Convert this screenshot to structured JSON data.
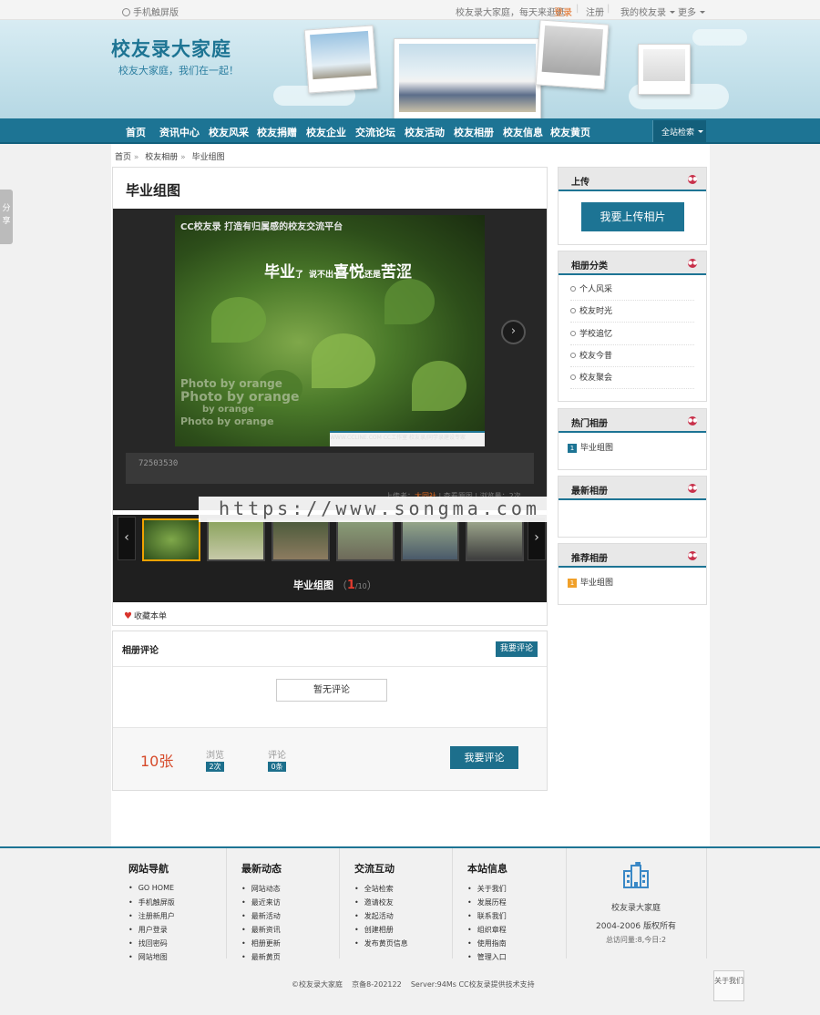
{
  "topbar": {
    "mobile": "手机触屏版",
    "welcome": "校友录大家庭，每天来逛逛",
    "login": "登录",
    "register": "注册",
    "my_alumni": "我的校友录",
    "more": "更多"
  },
  "banner": {
    "title": "校友录大家庭",
    "slogan": "校友大家庭，我们在一起！"
  },
  "nav": {
    "items": [
      "首页",
      "资讯中心",
      "校友风采",
      "校友捐赠",
      "校友企业",
      "交流论坛",
      "校友活动",
      "校友相册",
      "校友信息",
      "校友黄页"
    ],
    "search": "全站检索"
  },
  "breadcrumb": [
    "首页",
    "校友相册",
    "毕业组图"
  ],
  "album": {
    "title": "毕业组图",
    "photo_text": {
      "top": "CC校友录 打造有归属感的校友交流平台",
      "big_1": "毕业",
      "big_small_1": "了",
      "big_small_2": "说不出",
      "big_2": "喜悦",
      "big_small_3": "还是",
      "big_3": "苦涩",
      "watermarks": [
        "Photo by orange",
        "Photo by orange",
        "by orange",
        "Photo by orange"
      ],
      "footer": "WWW.CCLINE.COM CC工作室 校友录/同学录建设专家"
    },
    "caption": "72503530",
    "uploader_label": "上传者：",
    "uploader": "大同社",
    "original_label": "查看原图",
    "views_label": "浏览量：2次",
    "counter_name": "毕业组图",
    "counter_current": "1",
    "counter_total": "/10",
    "favorite": "收藏本单"
  },
  "watermark_text": "https://www.songma.com",
  "comments": {
    "title": "相册评论",
    "write_button": "我要评论",
    "empty": "暂无评论",
    "count": "10张",
    "views_label": "浏览",
    "views_value": "2次",
    "comments_label": "评论",
    "comments_value": "0条",
    "big_button": "我要评论"
  },
  "sidebar": {
    "upload_head": "上传",
    "upload_button": "我要上传相片",
    "category_head": "相册分类",
    "categories": [
      "个人风采",
      "校友时光",
      "学校追忆",
      "校友今昔",
      "校友聚会"
    ],
    "hot_head": "热门相册",
    "hot_items": [
      {
        "rank": "1",
        "name": "毕业组图"
      }
    ],
    "latest_head": "最新相册",
    "recommended_head": "推荐相册",
    "recommended_items": [
      {
        "rank": "1",
        "name": "毕业组图"
      }
    ]
  },
  "share": "分享",
  "footer": {
    "cols": [
      {
        "title": "网站导航",
        "items": [
          "GO HOME",
          "手机触屏版",
          "注册新用户",
          "用户登录",
          "找回密码",
          "网站地图"
        ]
      },
      {
        "title": "最新动态",
        "items": [
          "网站动态",
          "最近来访",
          "最新活动",
          "最新资讯",
          "相册更新",
          "最新黄页"
        ]
      },
      {
        "title": "交流互动",
        "items": [
          "全站检索",
          "邀请校友",
          "发起活动",
          "创建相册",
          "发布黄页信息"
        ]
      },
      {
        "title": "本站信息",
        "items": [
          "关于我们",
          "发展历程",
          "联系我们",
          "组织章程",
          "使用指南",
          "管理入口"
        ]
      }
    ],
    "site_name": "校友录大家庭",
    "years": "2004-2006 版权所有",
    "visits": "总访问量:8,今日:2",
    "copyright": "©校友录大家庭    京备8-202122    Server:94Ms CC校友录提供技术支持",
    "about": "关于我们"
  },
  "colors": {
    "brand": "#1d7494",
    "accent_orange": "#e06a1e",
    "highlight_red": "#d64a2a"
  }
}
